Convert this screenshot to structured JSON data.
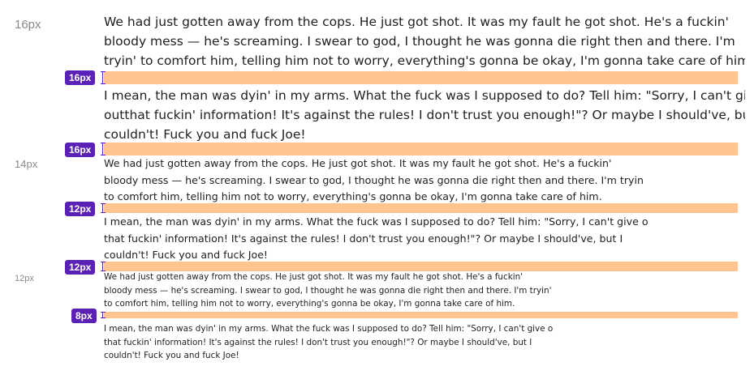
{
  "sections": [
    {
      "size_label": "16px",
      "paragraphs": [
        {
          "lines": [
            "We had just gotten away from the cops. He just got shot. It was my fault he got shot. He's a fuckin'",
            "bloody mess — he's screaming. I swear to god, I thought he was gonna die right then and there. I'm",
            "tryin' to comfort him, telling him not to worry, everything's gonna be okay, I'm gonna take care of him."
          ]
        },
        {
          "lines": [
            "I mean, the man was dyin' in my arms. What the fuck was I supposed to do? Tell him: \"Sorry, I can't give",
            "outthat fuckin' information! It's against the rules! I don't trust you enough!\"? Or maybe I should've, but I",
            "couldn't! Fuck you and fuck Joe!"
          ]
        }
      ],
      "gap_badges": [
        "16px",
        "16px"
      ]
    },
    {
      "size_label": "14px",
      "paragraphs": [
        {
          "lines": [
            "We had just gotten away from the cops. He just got shot. It was my fault he got shot. He's a fuckin'",
            "bloody mess — he's screaming. I swear to god, I thought he was gonna die right then and there. I'm tryin",
            "to comfort him, telling him not to worry, everything's gonna be okay, I'm gonna take care of him."
          ]
        },
        {
          "lines": [
            "I mean, the man was dyin' in my arms. What the fuck was I supposed to do? Tell him: \"Sorry, I can't give o",
            "that fuckin' information! It's against the rules! I don't trust you enough!\"? Or maybe I should've, but I",
            "couldn't! Fuck you and fuck Joe!"
          ]
        }
      ],
      "gap_badges": [
        "12px",
        "12px"
      ]
    },
    {
      "size_label": "12px",
      "paragraphs": [
        {
          "lines": [
            "We had just gotten away from the cops. He just got shot. It was my fault he got shot. He's a fuckin'",
            "bloody mess — he's screaming. I swear to god, I thought he was gonna die right then and there. I'm tryin'",
            "to comfort him, telling him not to worry, everything's gonna be okay, I'm gonna take care of him."
          ]
        },
        {
          "lines": [
            "I mean, the man was dyin' in my arms. What the fuck was I supposed to do? Tell him: \"Sorry, I can't give o",
            "that fuckin' information! It's against the rules! I don't trust you enough!\"? Or maybe I should've, but I",
            "couldn't! Fuck you and fuck Joe!"
          ]
        }
      ],
      "gap_badges": [
        "8px"
      ]
    }
  ],
  "colors": {
    "badge": "#5b21b6",
    "gap_bar": "#ffc48f",
    "size_label": "#8a8a8a",
    "text": "#1f1f1f"
  }
}
